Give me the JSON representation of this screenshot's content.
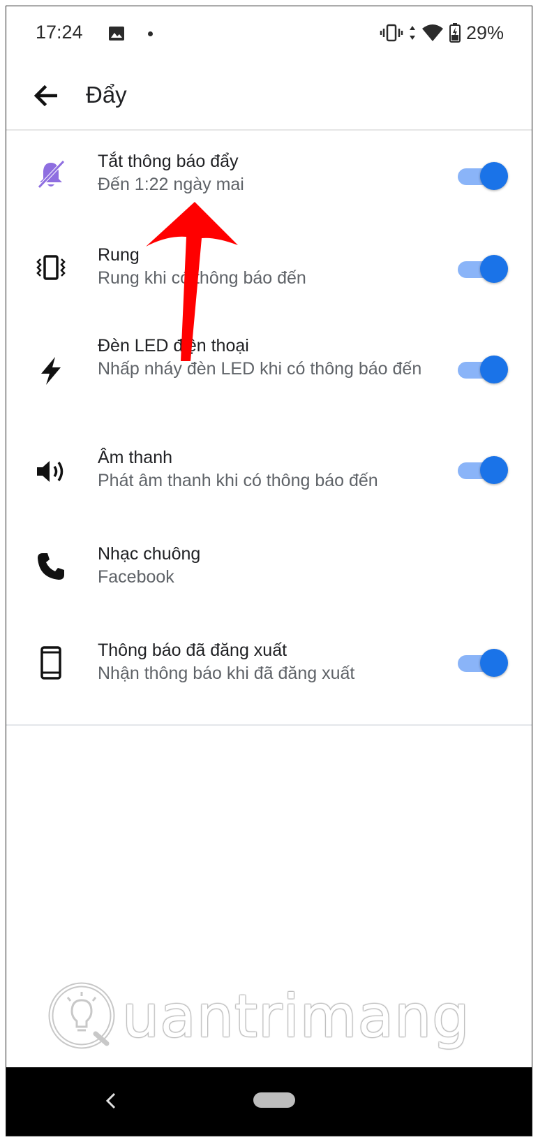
{
  "status_bar": {
    "time": "17:24",
    "battery_percent": "29%",
    "icons": [
      "image-icon",
      "notification-dot",
      "vibrate-icon",
      "data-arrows-icon",
      "wifi-icon",
      "battery-icon"
    ]
  },
  "app_bar": {
    "title": "Đẩy",
    "back_icon": "arrow-left-icon"
  },
  "settings": [
    {
      "icon": "bell-off-icon",
      "title": "Tắt thông báo đẩy",
      "subtitle": "Đến 1:22 ngày mai",
      "toggle": true,
      "icon_color": "#8e6ee0"
    },
    {
      "icon": "vibrate-icon",
      "title": "Rung",
      "subtitle": "Rung khi có thông báo đến",
      "toggle": true
    },
    {
      "icon": "flash-icon",
      "title": "Đèn LED điện thoại",
      "subtitle": "Nhấp nháy đèn LED khi có thông báo đến",
      "toggle": true
    },
    {
      "icon": "volume-icon",
      "title": "Âm thanh",
      "subtitle": "Phát âm thanh khi có thông báo đến",
      "toggle": true
    },
    {
      "icon": "phone-icon",
      "title": "Nhạc chuông",
      "subtitle": "Facebook",
      "toggle": false
    },
    {
      "icon": "smartphone-icon",
      "title": "Thông báo đã đăng xuất",
      "subtitle": "Nhận thông báo khi đã đăng xuất",
      "toggle": true
    }
  ],
  "watermark": {
    "text": "uantrimang"
  },
  "colors": {
    "accent": "#1a73e8",
    "track": "#8ab4f8",
    "annotation": "#ff0000",
    "nav_bar": "#000000"
  },
  "nav_bar": {
    "back_icon": "chevron-left-icon",
    "home_icon": "home-pill-icon"
  }
}
